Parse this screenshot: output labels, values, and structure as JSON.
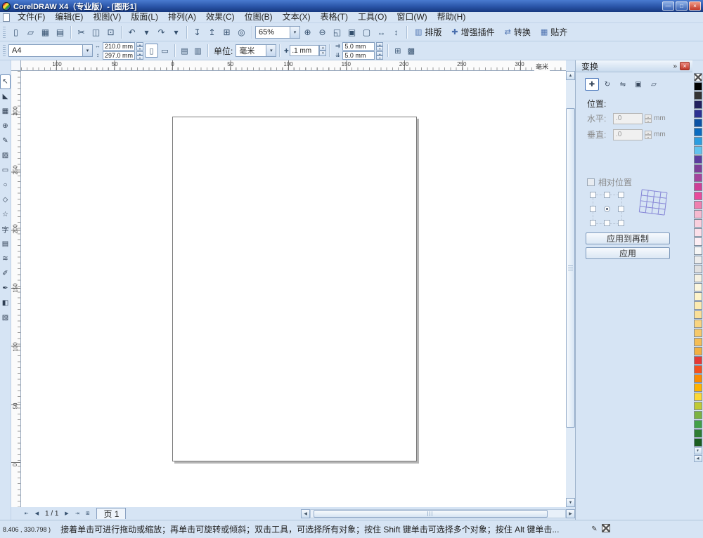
{
  "window": {
    "title": "CorelDRAW X4（专业版）- [图形1]"
  },
  "glyphs": {
    "minimize": "—",
    "maximize": "□",
    "close": "×",
    "dropdown": "▾",
    "spin_up": "▴",
    "spin_down": "▾",
    "scroll_up": "▲",
    "scroll_down": "▼",
    "scroll_left": "◀",
    "scroll_right": "▶",
    "width_icon": "↔",
    "height_icon": "↕",
    "portrait": "▯",
    "landscape": "▭",
    "all_pages": "▤",
    "current_page": "▥",
    "nudge_icon": "✚",
    "dup_x_icon": "⇉",
    "dup_y_icon": "⇊",
    "snap_grid": "⊞",
    "filled": "▩",
    "pen_icon": "✎"
  },
  "menu": {
    "items": [
      "文件(F)",
      "编辑(E)",
      "视图(V)",
      "版面(L)",
      "排列(A)",
      "效果(C)",
      "位图(B)",
      "文本(X)",
      "表格(T)",
      "工具(O)",
      "窗口(W)",
      "帮助(H)"
    ]
  },
  "toolbar": {
    "zoom_value": "65%",
    "file_icons": [
      {
        "name": "new-document-icon",
        "glyph": "▯"
      },
      {
        "name": "open-icon",
        "glyph": "▱"
      },
      {
        "name": "save-icon",
        "glyph": "▦"
      },
      {
        "name": "print-icon",
        "glyph": "▤"
      }
    ],
    "clipboard_icons": [
      {
        "name": "cut-icon",
        "glyph": "✂"
      },
      {
        "name": "copy-icon",
        "glyph": "◫"
      },
      {
        "name": "paste-icon",
        "glyph": "⊡"
      }
    ],
    "history_icons": [
      {
        "name": "undo-icon",
        "glyph": "↶"
      },
      {
        "name": "undo-dropdown-icon",
        "glyph": "▾"
      },
      {
        "name": "redo-icon",
        "glyph": "↷"
      },
      {
        "name": "redo-dropdown-icon",
        "glyph": "▾"
      }
    ],
    "transfer_icons": [
      {
        "name": "import-icon",
        "glyph": "↧"
      },
      {
        "name": "export-icon",
        "glyph": "↥"
      },
      {
        "name": "app-launcher-icon",
        "glyph": "⊞"
      },
      {
        "name": "corel-online-icon",
        "glyph": "◎"
      }
    ],
    "zoom_icons": [
      {
        "name": "zoom-in-icon",
        "glyph": "⊕"
      },
      {
        "name": "zoom-out-icon",
        "glyph": "⊖"
      },
      {
        "name": "zoom-selected-icon",
        "glyph": "◱"
      },
      {
        "name": "zoom-all-icon",
        "glyph": "▣"
      },
      {
        "name": "zoom-page-icon",
        "glyph": "▢"
      },
      {
        "name": "zoom-width-icon",
        "glyph": "↔"
      },
      {
        "name": "zoom-height-icon",
        "glyph": "↕"
      }
    ],
    "labeled_buttons": [
      {
        "name": "layout-button",
        "glyph": "▥",
        "label": "排版"
      },
      {
        "name": "plugins-button",
        "glyph": "✚",
        "label": "增强插件"
      },
      {
        "name": "convert-button",
        "glyph": "⇄",
        "label": "转换"
      },
      {
        "name": "snap-button",
        "glyph": "▦",
        "label": "贴齐"
      }
    ]
  },
  "property_bar": {
    "paper_size_value": "A4",
    "width_value": "210.0 mm",
    "height_value": "297.0 mm",
    "units_label": "单位:",
    "units_value": "毫米",
    "nudge_value": ".1 mm",
    "duplicate_x_value": "5.0 mm",
    "duplicate_y_value": "5.0 mm"
  },
  "rulers": {
    "unit_label": "毫米",
    "horizontal_labels": [
      "100",
      "50",
      "0",
      "50",
      "100",
      "150",
      "200",
      "250",
      "300"
    ],
    "vertical_labels": [
      "300",
      "250",
      "200",
      "150",
      "100",
      "50",
      "0"
    ]
  },
  "toolbox": {
    "tools": [
      {
        "name": "pick-tool",
        "glyph": "↖"
      },
      {
        "name": "shape-tool",
        "glyph": "◣"
      },
      {
        "name": "crop-tool",
        "glyph": "▦"
      },
      {
        "name": "zoom-tool",
        "glyph": "⊕"
      },
      {
        "name": "freehand-tool",
        "glyph": "✎"
      },
      {
        "name": "smart-fill-tool",
        "glyph": "▨"
      },
      {
        "name": "rectangle-tool",
        "glyph": "▭"
      },
      {
        "name": "ellipse-tool",
        "glyph": "○"
      },
      {
        "name": "polygon-tool",
        "glyph": "◇"
      },
      {
        "name": "basic-shapes-tool",
        "glyph": "☆"
      },
      {
        "name": "text-tool",
        "glyph": "字"
      },
      {
        "name": "table-tool",
        "glyph": "▤"
      },
      {
        "name": "blend-tool",
        "glyph": "≋"
      },
      {
        "name": "eyedropper-tool",
        "glyph": "✐"
      },
      {
        "name": "outline-tool",
        "glyph": "✒"
      },
      {
        "name": "fill-tool",
        "glyph": "◧"
      },
      {
        "name": "interactive-fill-tool",
        "glyph": "▧"
      }
    ]
  },
  "docker": {
    "title": "变换",
    "expand_glyph": "»",
    "transform_buttons": [
      {
        "name": "position-transform-button",
        "glyph": "✚"
      },
      {
        "name": "rotate-transform-button",
        "glyph": "↻"
      },
      {
        "name": "scale-mirror-transform-button",
        "glyph": "⇋"
      },
      {
        "name": "size-transform-button",
        "glyph": "▣"
      },
      {
        "name": "skew-transform-button",
        "glyph": "▱"
      }
    ],
    "position_label": "位置:",
    "horizontal_label": "水平:",
    "horizontal_value": ".0",
    "vertical_label": "垂直:",
    "vertical_value": ".0",
    "unit": "mm",
    "relative_position_label": "相对位置",
    "apply_to_duplicate_label": "应用到再制",
    "apply_label": "应用"
  },
  "palette": {
    "colors": [
      "#000000",
      "#333333",
      "#22215e",
      "#2d3192",
      "#0b52a5",
      "#0a6bc0",
      "#2b9de0",
      "#62c3ee",
      "#5b3c9e",
      "#7d3f98",
      "#a4449c",
      "#cf3f97",
      "#ea4a9c",
      "#f07faf",
      "#f6b9cf",
      "#f9cfdd",
      "#fbdfe9",
      "#fdeef4",
      "#f6f6f6",
      "#ececec",
      "#e0e0e0",
      "#f5f1e2",
      "#fbf6de",
      "#fdf3c9",
      "#fceab0",
      "#fadf98",
      "#f8d480",
      "#f6c96a",
      "#f4bd55",
      "#f1b041",
      "#e53935",
      "#f4511e",
      "#fb8c00",
      "#ffb300",
      "#fdd835",
      "#c0ca33",
      "#7cb342",
      "#43a047",
      "#2e7d32",
      "#1b5e20"
    ]
  },
  "page_nav": {
    "first_glyph": "⇤",
    "prev_glyph": "◀",
    "counter": "1 / 1",
    "next_glyph": "▶",
    "last_glyph": "⇥",
    "add_glyph": "⊞",
    "tab_label": "页 1"
  },
  "status_bar": {
    "coordinates": "8.406 , 330.798 )",
    "hint": "接着单击可进行拖动或缩放；再单击可旋转或倾斜；双击工具，可选择所有对象；按住 Shift 键单击可选择多个对象；按住 Alt 键单击..."
  },
  "colors": {
    "titlebar_top": "#4a7bd0",
    "titlebar_bottom": "#17387f",
    "chrome": "#d6e4f4",
    "docker_close_red": "#c0392b",
    "page_border": "#7a7a7a"
  }
}
